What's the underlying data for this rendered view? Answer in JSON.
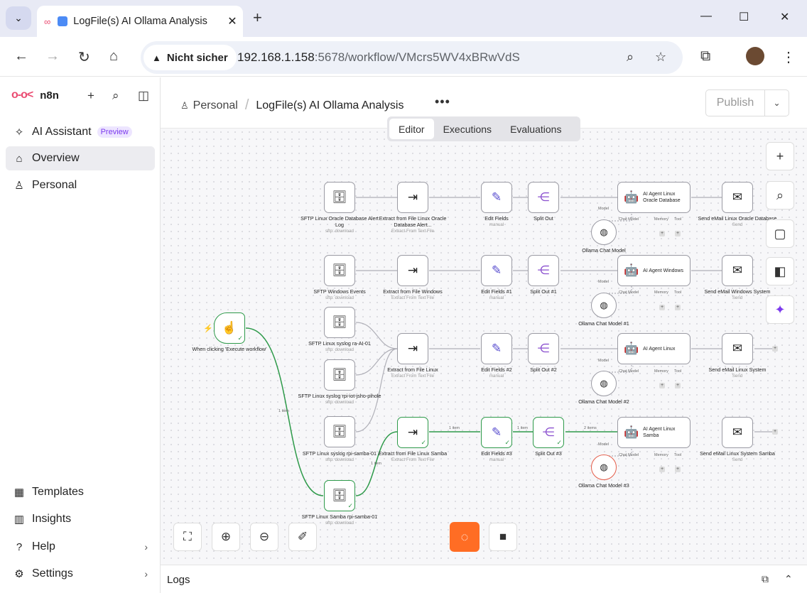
{
  "browser": {
    "tab_title": "LogFile(s) AI Ollama Analysis",
    "security_label": "Nicht sicher",
    "url_host": "192.168.1.158",
    "url_rest": ":5678/workflow/VMcrs5WV4xBRwVdS"
  },
  "sidebar": {
    "app_name": "n8n",
    "items": [
      {
        "label": "AI Assistant",
        "badge": "Preview"
      },
      {
        "label": "Overview"
      },
      {
        "label": "Personal"
      },
      {
        "label": "Templates"
      },
      {
        "label": "Insights"
      },
      {
        "label": "Help"
      },
      {
        "label": "Settings"
      }
    ]
  },
  "header": {
    "crumb_root": "Personal",
    "workflow_name": "LogFile(s) AI Ollama Analysis",
    "publish_label": "Publish",
    "tabs": [
      "Editor",
      "Executions",
      "Evaluations"
    ]
  },
  "nodes": {
    "trigger": {
      "label": "When clicking 'Execute workflow'"
    },
    "r1_sftp": {
      "label": "SFTP Linux Oracle Database Alert Log",
      "sub": "sftp: download"
    },
    "r1_extract": {
      "label": "Extract from File Linux Oracle Database Alert...",
      "sub": "Extract From Text File"
    },
    "r1_edit": {
      "label": "Edit Fields",
      "sub": "manual"
    },
    "r1_split": {
      "label": "Split Out"
    },
    "r1_agent": {
      "label": "AI Agent Linux Oracle Database"
    },
    "r1_mail": {
      "label": "Send eMail Linux Oracle Database",
      "sub": "Send"
    },
    "r1_model": {
      "label": "Ollama Chat Model"
    },
    "r2_sftp": {
      "label": "SFTP Windows Events",
      "sub": "sftp: download"
    },
    "r2_extract": {
      "label": "Extract from File Windows",
      "sub": "Extract From Text File"
    },
    "r2_edit": {
      "label": "Edit Fields #1",
      "sub": "manual"
    },
    "r2_split": {
      "label": "Split Out #1"
    },
    "r2_agent": {
      "label": "AI Agent Windows"
    },
    "r2_mail": {
      "label": "Send eMail Windows System",
      "sub": "Send"
    },
    "r2_model": {
      "label": "Ollama Chat Model #1"
    },
    "r3_sftp_a": {
      "label": "SFTP Linux syslog ra-AI-01",
      "sub": "sftp: download"
    },
    "r3_sftp_b": {
      "label": "SFTP Linux syslog rpi-iot-jsho-pihole",
      "sub": "sftp: download"
    },
    "r3_sftp_c": {
      "label": "SFTP Linux syslog rpi-samba-01",
      "sub": "sftp: download"
    },
    "r3_extract": {
      "label": "Extract from File Linux",
      "sub": "Extract From Text File"
    },
    "r3_edit": {
      "label": "Edit Fields #2",
      "sub": "manual"
    },
    "r3_split": {
      "label": "Split Out #2"
    },
    "r3_agent": {
      "label": "AI Agent Linux"
    },
    "r3_mail": {
      "label": "Send eMail Linux System",
      "sub": "Send"
    },
    "r3_model": {
      "label": "Ollama Chat Model #2"
    },
    "r4_sftp": {
      "label": "SFTP Linux Samba rpi-samba-01",
      "sub": "sftp: download"
    },
    "r4_extract": {
      "label": "Extract from File Linux Samba",
      "sub": "Extract From Text File"
    },
    "r4_edit": {
      "label": "Edit Fields #3",
      "sub": "manual"
    },
    "r4_split": {
      "label": "Split Out #3"
    },
    "r4_agent": {
      "label": "AI Agent Linux Samba"
    },
    "r4_mail": {
      "label": "Send eMail Linux System Samba",
      "sub": "Send"
    },
    "r4_model": {
      "label": "Ollama Chat Model #3"
    }
  },
  "ports": {
    "model": "Model",
    "chat_model": "Chat Model",
    "memory": "Memory",
    "tool": "Tool"
  },
  "edges": {
    "one_item": "1 item",
    "two_items": "2 items"
  },
  "footer": {
    "logs_label": "Logs"
  },
  "colors": {
    "accent": "#ea4b71",
    "success": "#2e9a4a",
    "run": "#ff6d24"
  }
}
